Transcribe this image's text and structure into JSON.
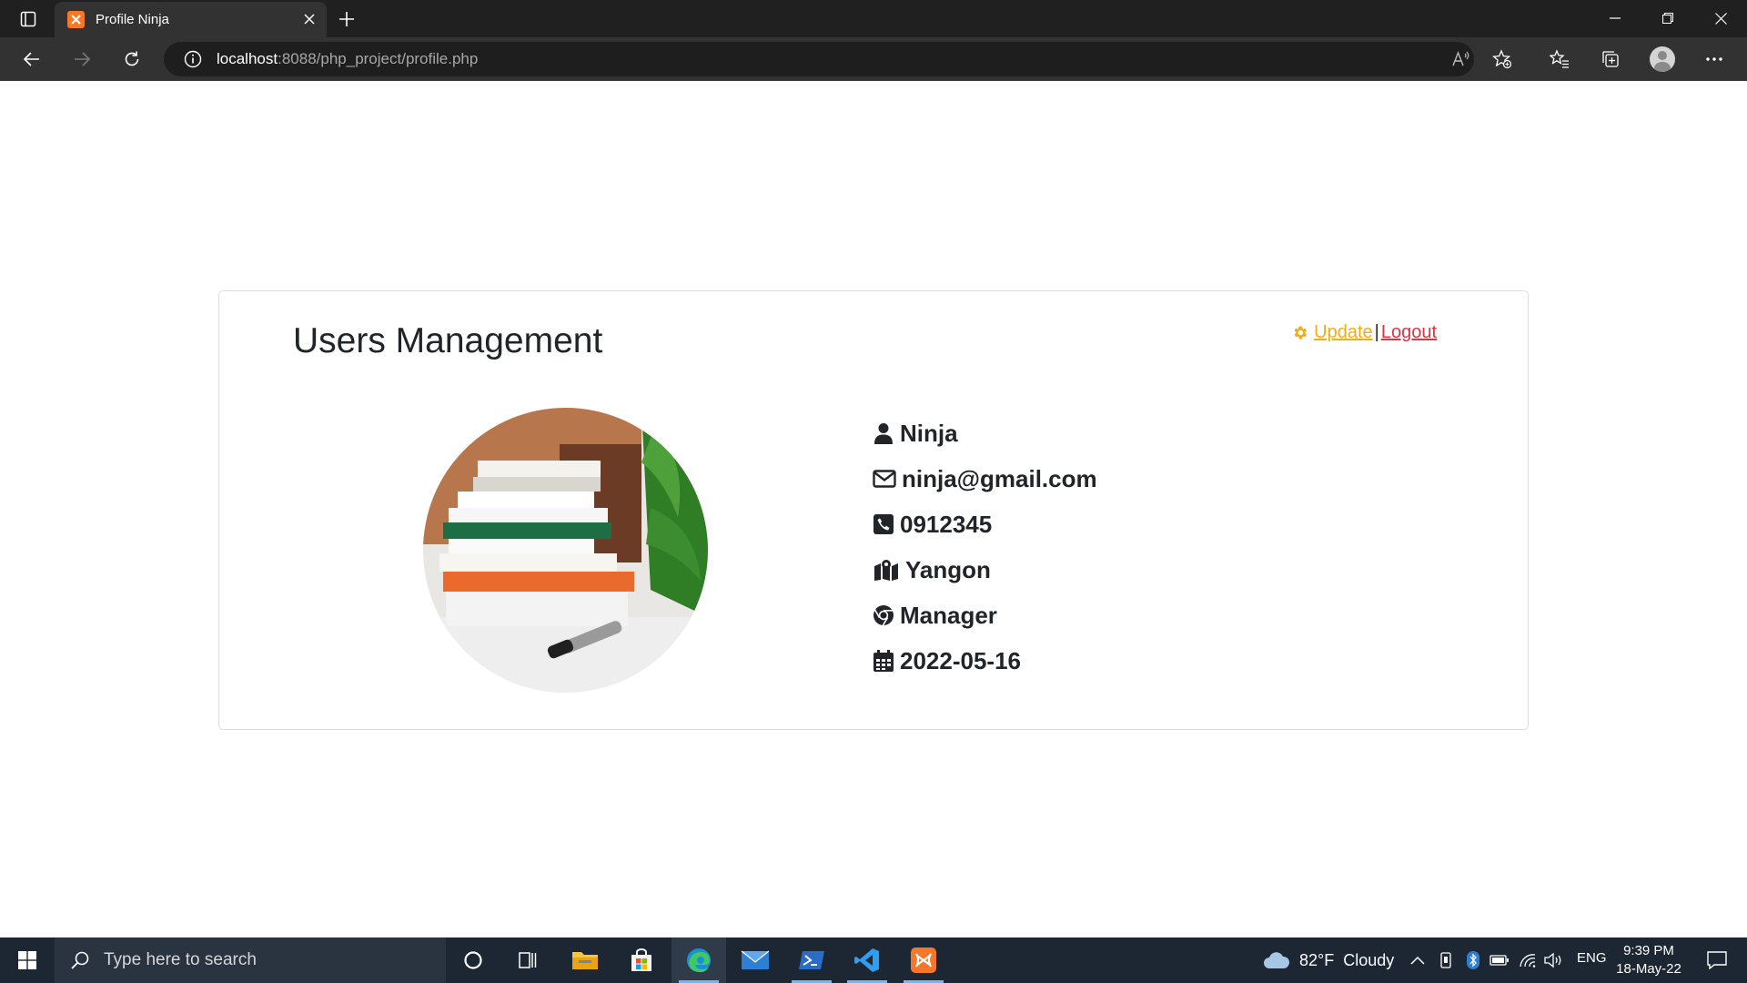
{
  "browser": {
    "tab_title": "Profile Ninja",
    "url_host": "localhost",
    "url_rest": ":8088/php_project/profile.php"
  },
  "page": {
    "title": "Users Management",
    "update_label": " Update ",
    "separator": "|",
    "logout_label": "Logout",
    "profile": {
      "name": "Ninja",
      "email": "ninja@gmail.com",
      "phone": "0912345",
      "city": "Yangon",
      "role": "Manager",
      "date": "2022-05-16"
    }
  },
  "taskbar": {
    "search_placeholder": "Type here to search",
    "weather_temp": "82°F",
    "weather_desc": "Cloudy",
    "language": "ENG",
    "time": "9:39 PM",
    "date": "18-May-22"
  },
  "colors": {
    "update_link": "#f0ad18",
    "logout_link": "#dc3545",
    "chrome_dark": "#202020",
    "taskbar": "#1c2733"
  }
}
